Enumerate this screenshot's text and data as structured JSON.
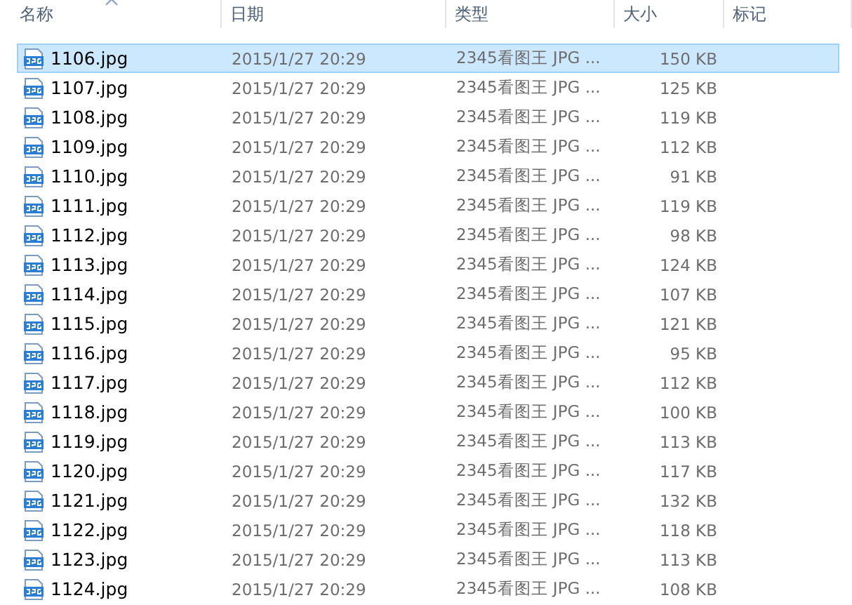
{
  "columns": [
    {
      "label": "名称",
      "sorted": true
    },
    {
      "label": "日期",
      "sorted": false
    },
    {
      "label": "类型",
      "sorted": false
    },
    {
      "label": "大小",
      "sorted": false
    },
    {
      "label": "标记",
      "sorted": false
    }
  ],
  "rows": [
    {
      "name": "1106.jpg",
      "date": "2015/1/27 20:29",
      "type": "2345看图王 JPG ...",
      "size": "150 KB",
      "selected": true
    },
    {
      "name": "1107.jpg",
      "date": "2015/1/27 20:29",
      "type": "2345看图王 JPG ...",
      "size": "125 KB",
      "selected": false
    },
    {
      "name": "1108.jpg",
      "date": "2015/1/27 20:29",
      "type": "2345看图王 JPG ...",
      "size": "119 KB",
      "selected": false
    },
    {
      "name": "1109.jpg",
      "date": "2015/1/27 20:29",
      "type": "2345看图王 JPG ...",
      "size": "112 KB",
      "selected": false
    },
    {
      "name": "1110.jpg",
      "date": "2015/1/27 20:29",
      "type": "2345看图王 JPG ...",
      "size": "91 KB",
      "selected": false
    },
    {
      "name": "1111.jpg",
      "date": "2015/1/27 20:29",
      "type": "2345看图王 JPG ...",
      "size": "119 KB",
      "selected": false
    },
    {
      "name": "1112.jpg",
      "date": "2015/1/27 20:29",
      "type": "2345看图王 JPG ...",
      "size": "98 KB",
      "selected": false
    },
    {
      "name": "1113.jpg",
      "date": "2015/1/27 20:29",
      "type": "2345看图王 JPG ...",
      "size": "124 KB",
      "selected": false
    },
    {
      "name": "1114.jpg",
      "date": "2015/1/27 20:29",
      "type": "2345看图王 JPG ...",
      "size": "107 KB",
      "selected": false
    },
    {
      "name": "1115.jpg",
      "date": "2015/1/27 20:29",
      "type": "2345看图王 JPG ...",
      "size": "121 KB",
      "selected": false
    },
    {
      "name": "1116.jpg",
      "date": "2015/1/27 20:29",
      "type": "2345看图王 JPG ...",
      "size": "95 KB",
      "selected": false
    },
    {
      "name": "1117.jpg",
      "date": "2015/1/27 20:29",
      "type": "2345看图王 JPG ...",
      "size": "112 KB",
      "selected": false
    },
    {
      "name": "1118.jpg",
      "date": "2015/1/27 20:29",
      "type": "2345看图王 JPG ...",
      "size": "100 KB",
      "selected": false
    },
    {
      "name": "1119.jpg",
      "date": "2015/1/27 20:29",
      "type": "2345看图王 JPG ...",
      "size": "113 KB",
      "selected": false
    },
    {
      "name": "1120.jpg",
      "date": "2015/1/27 20:29",
      "type": "2345看图王 JPG ...",
      "size": "117 KB",
      "selected": false
    },
    {
      "name": "1121.jpg",
      "date": "2015/1/27 20:29",
      "type": "2345看图王 JPG ...",
      "size": "132 KB",
      "selected": false
    },
    {
      "name": "1122.jpg",
      "date": "2015/1/27 20:29",
      "type": "2345看图王 JPG ...",
      "size": "118 KB",
      "selected": false
    },
    {
      "name": "1123.jpg",
      "date": "2015/1/27 20:29",
      "type": "2345看图王 JPG ...",
      "size": "113 KB",
      "selected": false
    },
    {
      "name": "1124.jpg",
      "date": "2015/1/27 20:29",
      "type": "2345看图王 JPG ...",
      "size": "108 KB",
      "selected": false
    }
  ]
}
